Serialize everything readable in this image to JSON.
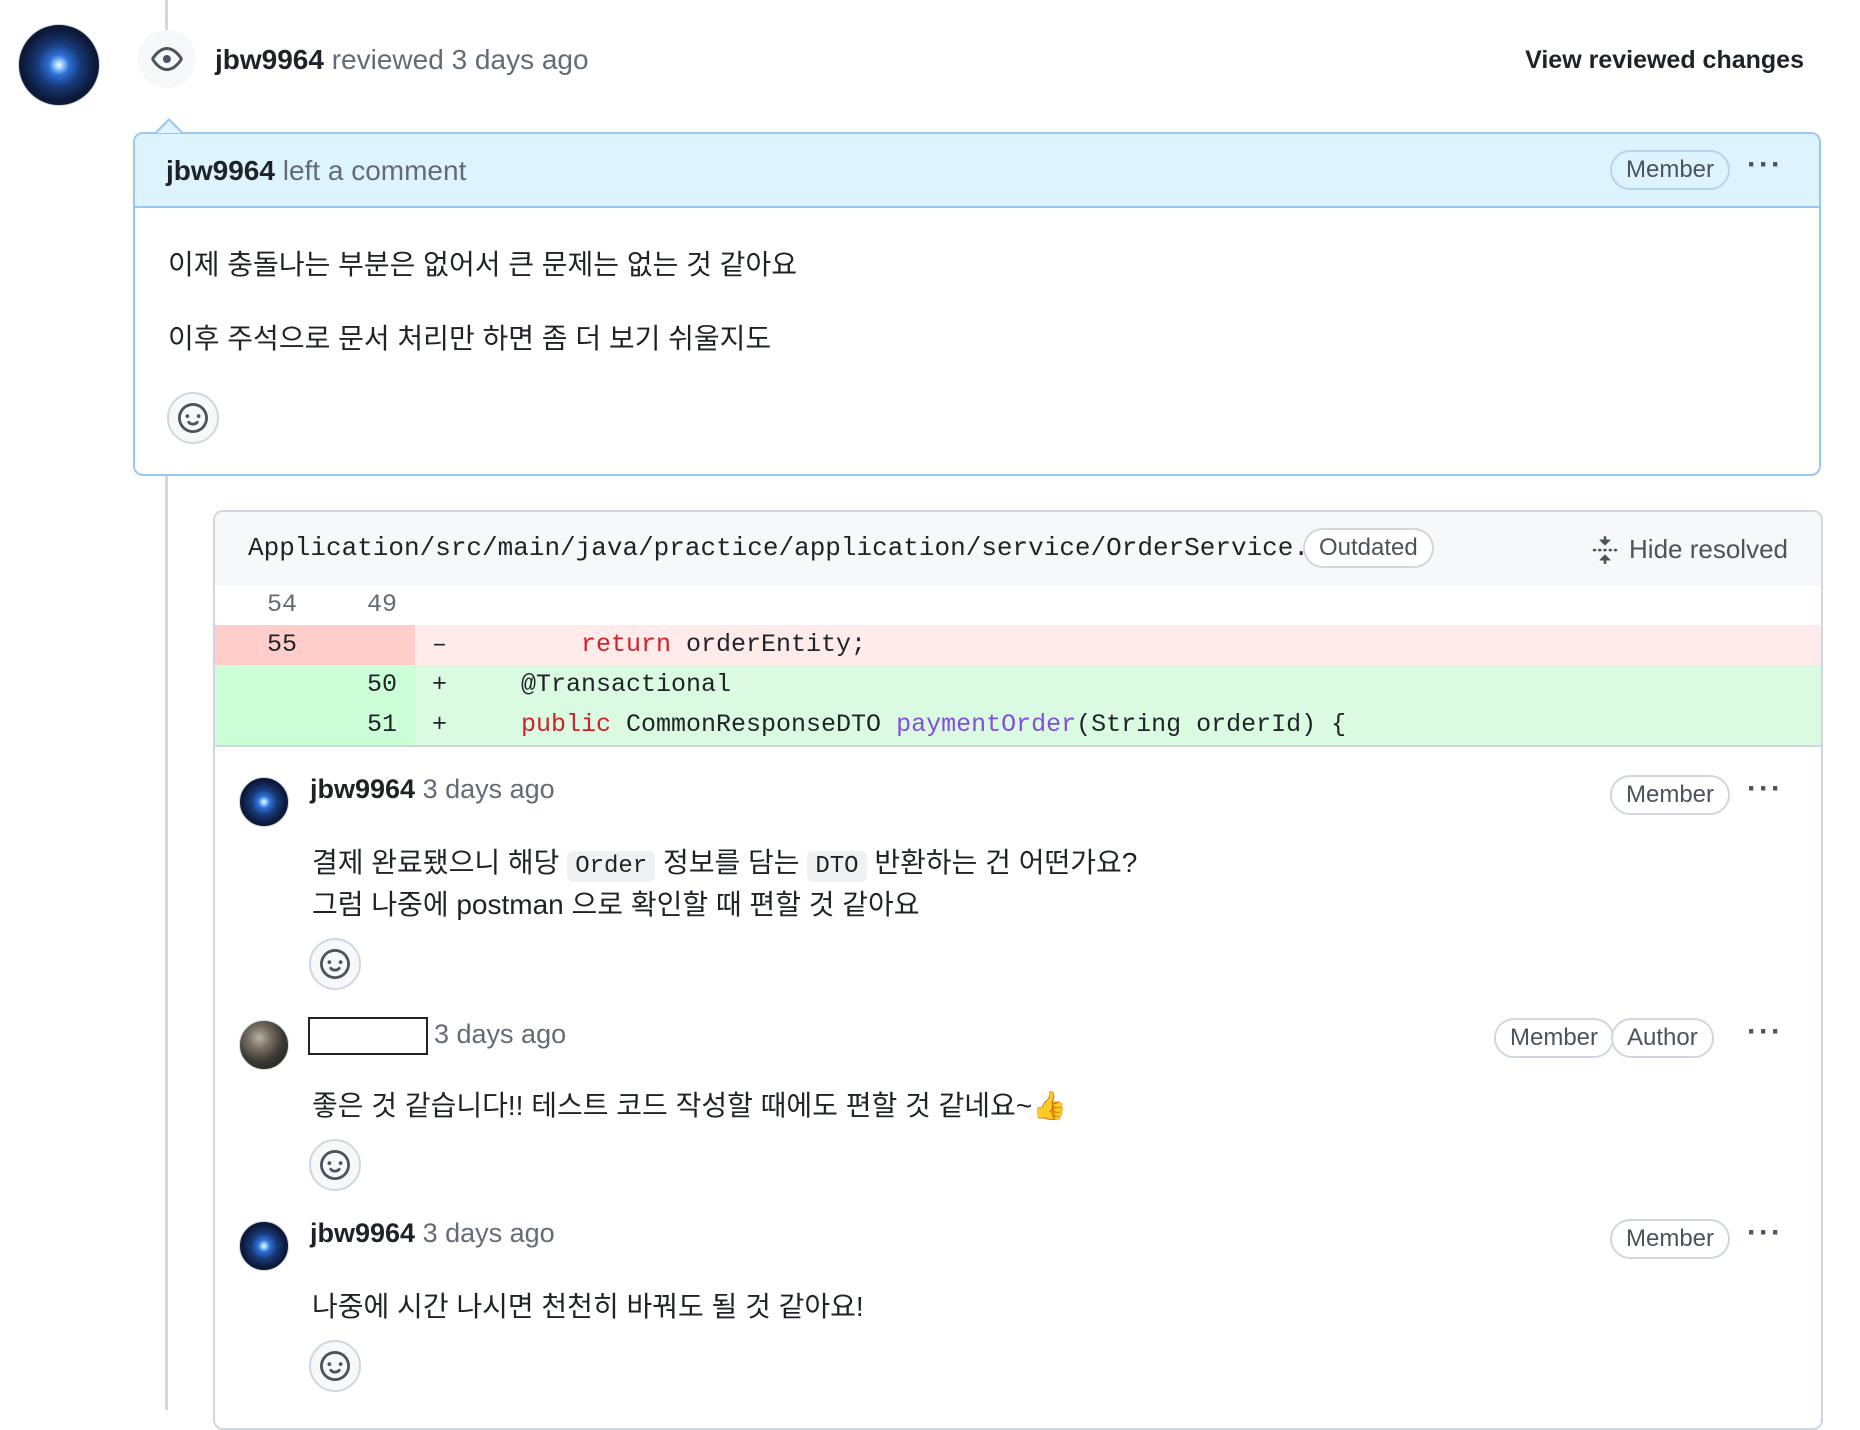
{
  "review": {
    "author": "jbw9964",
    "action": " reviewed ",
    "time": "3 days ago",
    "view_changes_label": "View reviewed changes"
  },
  "comment": {
    "author": "jbw9964",
    "action": " left a comment",
    "badge": "Member",
    "more_label": "···",
    "paragraph1": "이제 충돌나는 부분은 없어서 큰 문제는 없는 것 같아요",
    "paragraph2": "이후 주석으로 문서 처리만 하면 좀 더 보기 쉬울지도"
  },
  "thread": {
    "file_path": "Application/src/main/java/practice/application/service/OrderService.java",
    "outdated_label": "Outdated",
    "hide_resolved_label": "Hide resolved",
    "diff": [
      {
        "type": "context",
        "old": "54",
        "new": "49",
        "sign": "",
        "code": ""
      },
      {
        "type": "del",
        "old": "55",
        "new": "",
        "sign": "–",
        "code_kw": "return",
        "code_rest": " orderEntity;"
      },
      {
        "type": "add",
        "old": "",
        "new": "50",
        "sign": "+",
        "code_anno": "@Transactional"
      },
      {
        "type": "add",
        "old": "",
        "new": "51",
        "sign": "+",
        "code_kw": "public",
        "code_mid": " CommonResponseDTO ",
        "code_fn": "paymentOrder",
        "code_rest": "(String orderId) {"
      }
    ],
    "comments": [
      {
        "author": "jbw9964",
        "time": "3 days ago",
        "badges": [
          "Member"
        ],
        "line1_a": "결제 완료됐으니 해당 ",
        "line1_code1": "Order",
        "line1_b": " 정보를 담는 ",
        "line1_code2": "DTO",
        "line1_c": " 반환하는 건 어떤가요?",
        "line2": "그럼 나중에 postman 으로 확인할 때 편할 것 같아요"
      },
      {
        "author": "",
        "time": "3 days ago",
        "badges": [
          "Member",
          "Author"
        ],
        "line1": "좋은 것 같습니다!! 테스트 코드 작성할 때에도 편할 것 같네요~👍"
      },
      {
        "author": "jbw9964",
        "time": "3 days ago",
        "badges": [
          "Member"
        ],
        "line1": "나중에 시간 나시면 천천히 바꿔도 될 것 같아요!"
      }
    ]
  },
  "icons": {
    "eye": "eye-icon",
    "smiley": "smiley-icon",
    "unfold": "unfold-icon",
    "kebab": "kebab-horizontal-icon"
  },
  "colors": {
    "comment_header_bg": "#ddf4ff",
    "comment_border": "#9ac6f2",
    "diff_del_bg": "#ffebe9",
    "diff_add_bg": "#dafbe1"
  }
}
